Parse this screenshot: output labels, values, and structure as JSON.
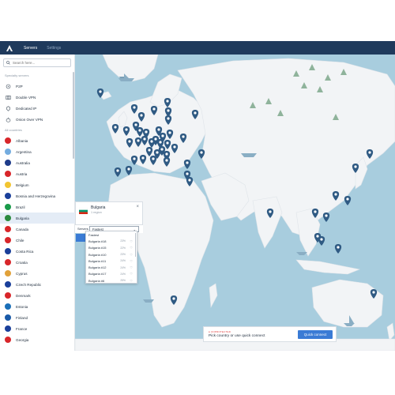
{
  "header": {
    "tabs": [
      {
        "label": "Servers"
      },
      {
        "label": "Settings"
      }
    ]
  },
  "search": {
    "placeholder": "Search here..."
  },
  "sidebar": {
    "sections": {
      "specialty": "Specialty servers",
      "countries": "All countries"
    },
    "specialty_items": [
      {
        "label": "P2P",
        "icon": "p2p-icon"
      },
      {
        "label": "Double VPN",
        "icon": "double-vpn-icon"
      },
      {
        "label": "Dedicated IP",
        "icon": "dedicated-ip-icon"
      },
      {
        "label": "Onion Over VPN",
        "icon": "onion-icon"
      }
    ],
    "countries": [
      {
        "label": "Albania",
        "color": "#d8262a"
      },
      {
        "label": "Argentina",
        "color": "#74acdf"
      },
      {
        "label": "Australia",
        "color": "#1e3b8a"
      },
      {
        "label": "Austria",
        "color": "#d8262a"
      },
      {
        "label": "Belgium",
        "color": "#f2c531"
      },
      {
        "label": "Bosnia and Herzegovina",
        "color": "#1a3f9a"
      },
      {
        "label": "Brazil",
        "color": "#1a9a4a"
      },
      {
        "label": "Bulgaria",
        "color": "#2b8a3e",
        "selected": true
      },
      {
        "label": "Canada",
        "color": "#d8262a"
      },
      {
        "label": "Chile",
        "color": "#d8262a"
      },
      {
        "label": "Costa Rica",
        "color": "#1a3f9a"
      },
      {
        "label": "Croatia",
        "color": "#d8262a"
      },
      {
        "label": "Cyprus",
        "color": "#e1a13a"
      },
      {
        "label": "Czech Republic",
        "color": "#1a3f9a"
      },
      {
        "label": "Denmark",
        "color": "#d8262a"
      },
      {
        "label": "Estonia",
        "color": "#1a6fb8"
      },
      {
        "label": "Finland",
        "color": "#1a5aa8"
      },
      {
        "label": "France",
        "color": "#1a3f9a"
      },
      {
        "label": "Georgia",
        "color": "#d8262a"
      }
    ]
  },
  "popup": {
    "country": "Bulgaria",
    "subtitle": "1 region",
    "close": "×",
    "server_label": "Servers",
    "selected": "Fastest",
    "options": [
      {
        "label": "Fastest",
        "load": "",
        "fav": ""
      },
      {
        "label": "Bulgaria #18",
        "load": "23%",
        "fav": "♡"
      },
      {
        "label": "Bulgaria #15",
        "load": "22%",
        "fav": "♡"
      },
      {
        "label": "Bulgaria #10",
        "load": "23%",
        "fav": "♡"
      },
      {
        "label": "Bulgaria #11",
        "load": "24%",
        "fav": "♡"
      },
      {
        "label": "Bulgaria #12",
        "load": "24%",
        "fav": "♡"
      },
      {
        "label": "Bulgaria #17",
        "load": "24%",
        "fav": "♡"
      },
      {
        "label": "Bulgaria #6",
        "load": "25%",
        "fav": "♡"
      }
    ]
  },
  "connect": {
    "status": "● UNPROTECTED",
    "message": "Pick country or use quick connect",
    "button": "Quick connect"
  },
  "colors": {
    "ocean": "#a8cdde",
    "land": "#f2f4f6",
    "pin": "#2f5a83",
    "accent": "#3a7bd5",
    "topbar": "#1f3a5c"
  }
}
